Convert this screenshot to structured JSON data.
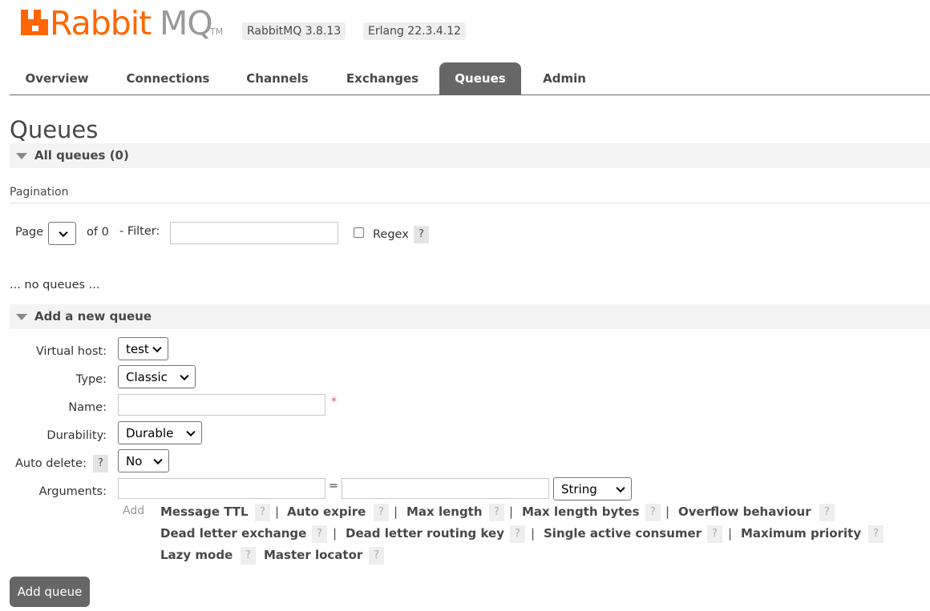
{
  "header": {
    "logo_text": "RabbitMQ",
    "logo_tm": "TM",
    "version_badge": "RabbitMQ 3.8.13",
    "erlang_badge": "Erlang 22.3.4.12",
    "brand_color": "#ff6600"
  },
  "tabs": [
    {
      "label": "Overview"
    },
    {
      "label": "Connections"
    },
    {
      "label": "Channels"
    },
    {
      "label": "Exchanges"
    },
    {
      "label": "Queues",
      "active": true
    },
    {
      "label": "Admin"
    }
  ],
  "page": {
    "title": "Queues",
    "all_queues_label": "All queues (0)",
    "pagination_label": "Pagination",
    "page_label": "Page",
    "page_of": "of 0",
    "filter_label": "- Filter:",
    "regex_label": "Regex",
    "help_mark": "?",
    "no_queues": "... no queues ..."
  },
  "add_queue": {
    "section_label": "Add a new queue",
    "virtual_host_label": "Virtual host:",
    "virtual_host_value": "test",
    "type_label": "Type:",
    "type_value": "Classic",
    "name_label": "Name:",
    "name_value": "",
    "required_mark": "*",
    "durability_label": "Durability:",
    "durability_value": "Durable",
    "auto_delete_label": "Auto delete:",
    "auto_delete_value": "No",
    "arguments_label": "Arguments:",
    "equals": "=",
    "arg_type_value": "String",
    "add_label": "Add",
    "arg_links": [
      "Message TTL",
      "Auto expire",
      "Max length",
      "Max length bytes",
      "Overflow behaviour",
      "Dead letter exchange",
      "Dead letter routing key",
      "Single active consumer",
      "Maximum priority",
      "Lazy mode",
      "Master locator"
    ],
    "separator": "|",
    "submit_label": "Add queue"
  }
}
